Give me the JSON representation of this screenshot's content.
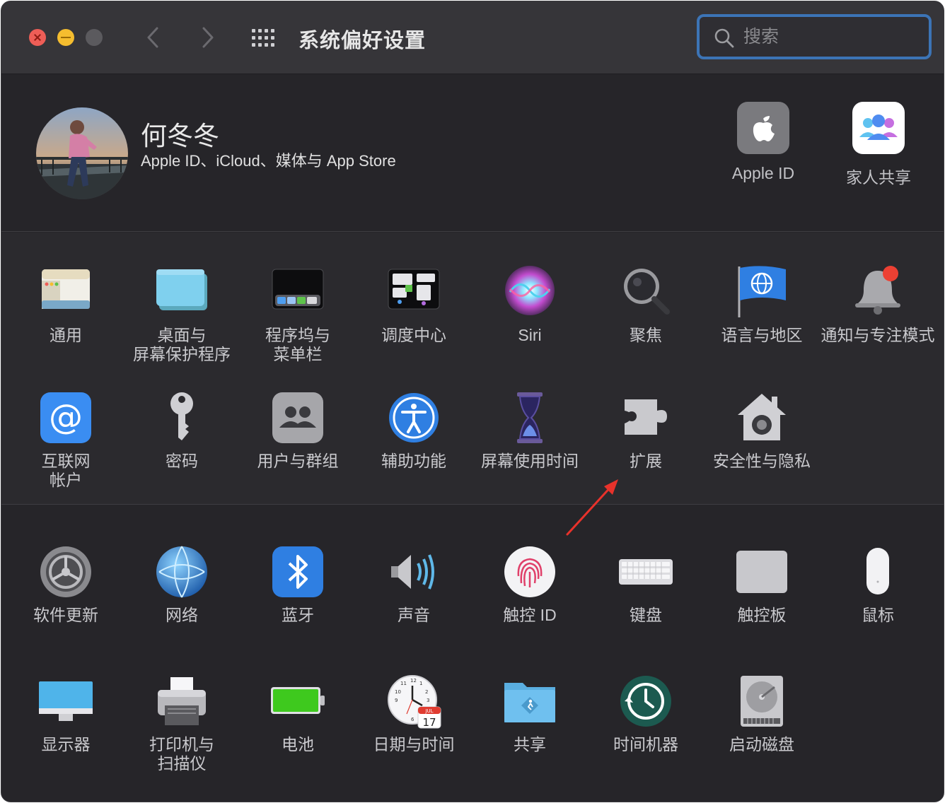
{
  "window": {
    "title": "系统偏好设置"
  },
  "search": {
    "placeholder": "搜索"
  },
  "profile": {
    "name": "何冬冬",
    "subtitle": "Apple ID、iCloud、媒体与 App Store",
    "apple_id_label": "Apple ID",
    "family_label": "家人共享"
  },
  "row1": [
    {
      "label": "通用",
      "icon": "general-icon"
    },
    {
      "label": "桌面与\n屏幕保护程序",
      "icon": "desktop-screensaver-icon"
    },
    {
      "label": "程序坞与\n菜单栏",
      "icon": "dock-menubar-icon"
    },
    {
      "label": "调度中心",
      "icon": "mission-control-icon"
    },
    {
      "label": "Siri",
      "icon": "siri-icon"
    },
    {
      "label": "聚焦",
      "icon": "spotlight-icon"
    },
    {
      "label": "语言与地区",
      "icon": "language-region-icon"
    },
    {
      "label": "通知与专注模式",
      "icon": "notifications-icon"
    }
  ],
  "row2": [
    {
      "label": "互联网\n帐户",
      "icon": "internet-accounts-icon"
    },
    {
      "label": "密码",
      "icon": "passwords-icon"
    },
    {
      "label": "用户与群组",
      "icon": "users-groups-icon"
    },
    {
      "label": "辅助功能",
      "icon": "accessibility-icon"
    },
    {
      "label": "屏幕使用时间",
      "icon": "screen-time-icon"
    },
    {
      "label": "扩展",
      "icon": "extensions-icon"
    },
    {
      "label": "安全性与隐私",
      "icon": "security-privacy-icon"
    }
  ],
  "row3": [
    {
      "label": "软件更新",
      "icon": "software-update-icon"
    },
    {
      "label": "网络",
      "icon": "network-icon"
    },
    {
      "label": "蓝牙",
      "icon": "bluetooth-icon"
    },
    {
      "label": "声音",
      "icon": "sound-icon"
    },
    {
      "label": "触控 ID",
      "icon": "touch-id-icon"
    },
    {
      "label": "键盘",
      "icon": "keyboard-icon"
    },
    {
      "label": "触控板",
      "icon": "trackpad-icon"
    },
    {
      "label": "鼠标",
      "icon": "mouse-icon"
    }
  ],
  "row4": [
    {
      "label": "显示器",
      "icon": "displays-icon"
    },
    {
      "label": "打印机与\n扫描仪",
      "icon": "printers-scanners-icon"
    },
    {
      "label": "电池",
      "icon": "battery-icon"
    },
    {
      "label": "日期与时间",
      "icon": "date-time-icon"
    },
    {
      "label": "共享",
      "icon": "sharing-icon"
    },
    {
      "label": "时间机器",
      "icon": "time-machine-icon"
    },
    {
      "label": "启动磁盘",
      "icon": "startup-disk-icon"
    }
  ],
  "calendar": {
    "month": "JUL",
    "day": "17"
  },
  "colors": {
    "accent": "#3c74b6",
    "annotation": "#e8322b"
  }
}
